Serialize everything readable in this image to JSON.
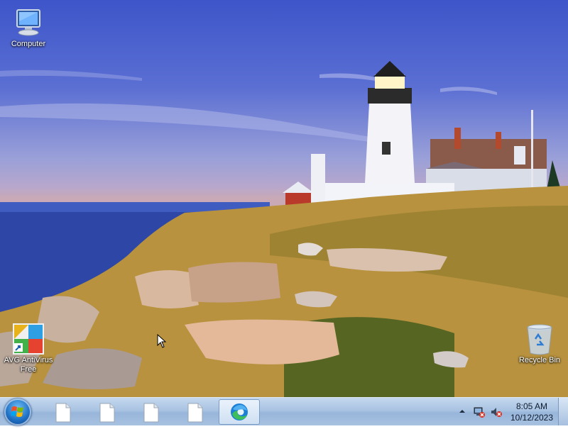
{
  "desktop": {
    "wallpaper": "lighthouse-coast",
    "icons": [
      {
        "label": "Computer",
        "icon": "computer-icon"
      },
      {
        "label": "AVG AntiVirus Free",
        "icon": "avg-antivirus-icon"
      },
      {
        "label": "Recycle Bin",
        "icon": "recycle-bin-icon"
      }
    ]
  },
  "taskbar": {
    "start_icon": "windows-start-orb",
    "buttons": [
      {
        "icon": "document-icon",
        "active": false
      },
      {
        "icon": "document-icon",
        "active": false
      },
      {
        "icon": "document-icon",
        "active": false
      },
      {
        "icon": "document-icon",
        "active": false
      },
      {
        "icon": "edge-browser-icon",
        "active": true
      }
    ],
    "tray": {
      "icons": [
        "show-hidden-icons-arrow",
        "network-disconnected-icon",
        "volume-muted-icon"
      ],
      "time": "8:05 AM",
      "date": "10/12/2023"
    }
  },
  "colors": {
    "sky_top": "#3d55c9",
    "sea": "#2e47a6",
    "taskbar": "#a9c3e2",
    "edge_blue": "#1b7fd6",
    "edge_green": "#3fbf5a"
  }
}
